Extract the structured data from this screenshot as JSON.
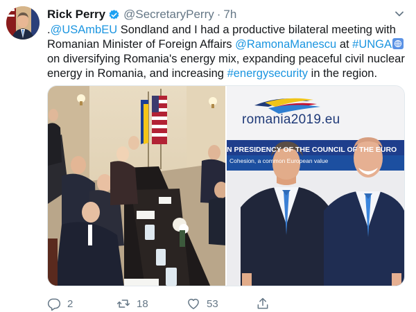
{
  "tweet": {
    "author_name": "Rick Perry",
    "handle": "@SecretaryPerry",
    "separator": "·",
    "time": "7h",
    "text_parts": {
      "p1": ".",
      "mention_1": "@USAmbEU",
      "p2": " Sondland and I had a productive bilateral meeting with Romanian Minister of Foreign Affairs ",
      "mention_2": "@RamonaManescu",
      "p3": " at ",
      "hashtag_1": "#UNGA",
      "p4": " on diversifying Romania's energy mix, expanding peaceful civil nuclear energy in Romania, and increasing ",
      "hashtag_2": "#energysecurity",
      "p5": " in the region."
    },
    "media": {
      "banner_logo_text": "romania2019.eu",
      "banner_presidency_text": "N PRESIDENCY OF THE COUNCIL OF THE EURO",
      "banner_cohesion_text": "Cohesion, a common European value"
    },
    "actions": {
      "reply_count": "2",
      "retweet_count": "18",
      "like_count": "53"
    }
  },
  "colors": {
    "link": "#1b95e0",
    "text": "#14171a",
    "muted": "#657786",
    "verified": "#1da1f2"
  },
  "icons": {
    "verified": "verified-badge-icon",
    "chevron": "chevron-down-icon",
    "globe": "un-globe-icon",
    "reply": "reply-icon",
    "retweet": "retweet-icon",
    "like": "heart-icon",
    "share": "share-icon"
  }
}
